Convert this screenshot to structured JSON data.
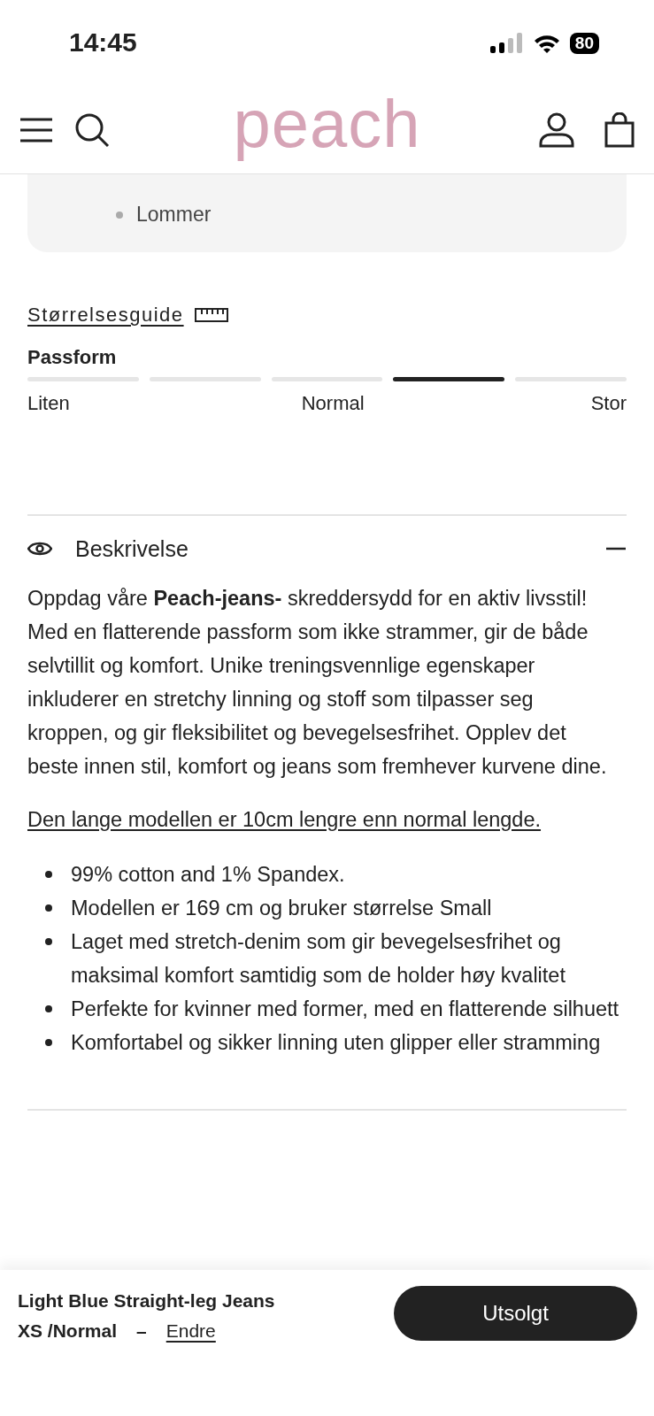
{
  "status_bar": {
    "time": "14:45",
    "battery": "80"
  },
  "header": {
    "logo": "peach"
  },
  "features": {
    "items": [
      "Lommer"
    ]
  },
  "size_guide": {
    "link": "Størrelsesguide"
  },
  "fit": {
    "title": "Passform",
    "segments": [
      {
        "selected": false
      },
      {
        "selected": false
      },
      {
        "selected": false
      },
      {
        "selected": true
      },
      {
        "selected": false
      }
    ],
    "labels": [
      "Liten",
      "Normal",
      "Stor"
    ]
  },
  "description": {
    "title": "Beskrivelse",
    "expanded": true,
    "paragraphs": [
      "Oppdag våre **Peach-jeans-** skreddersydd for en aktiv livsstil!",
      "Med en flatterende passform som ikke strammer, gir de både selvtillit og komfort. Unike treningsvennlige egenskaper inkluderer en stretchy linning og stoff som tilpasser seg kroppen, og gir fleksibilitet og bevegelsesfrihet. Opplev det beste innen stil, komfort og jeans som fremhever kurvene dine."
    ],
    "note": "Den lange modellen er 10cm lengre enn normal lengde.",
    "bullets": [
      "99% cotton and 1% Spandex.",
      "Modellen er 169 cm og bruker størrelse Small",
      "Laget med stretch-denim som gir bevegelsesfrihet og maksimal komfort samtidig som de holder høy kvalitet",
      "Perfekte for kvinner med former, med en flatterende silhuett",
      "Komfortabel og sikker linning uten glipper eller stramming"
    ]
  },
  "bottom_bar": {
    "product": "Light Blue Straight-leg Jeans",
    "variant": "XS /Normal",
    "separator": "–",
    "change_link": "Endre",
    "button": "Utsolgt"
  }
}
